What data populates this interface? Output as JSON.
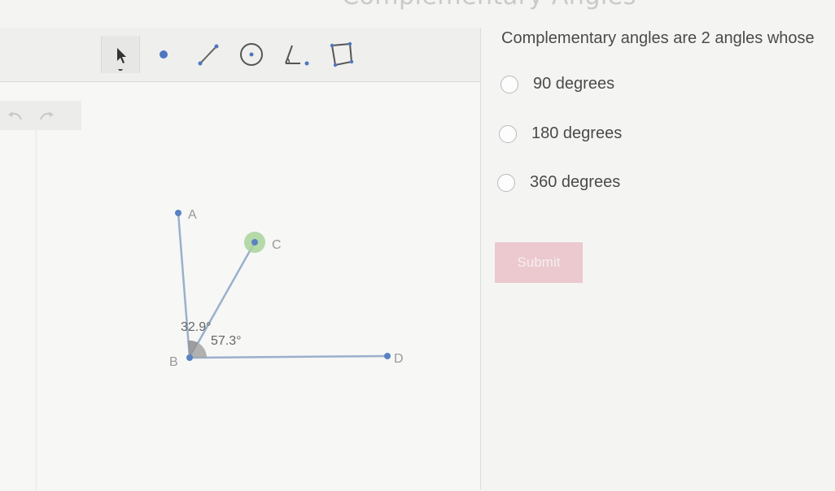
{
  "page": {
    "title": "Complementary Angles"
  },
  "toolbar": {
    "tools": [
      "arrow-select-icon",
      "point-icon",
      "segment-icon",
      "circle-icon",
      "angle-icon",
      "polygon-icon"
    ]
  },
  "history": {
    "undo_icon": "undo-icon",
    "redo_icon": "redo-icon"
  },
  "figure": {
    "points": {
      "A": "A",
      "B": "B",
      "C": "C",
      "D": "D"
    },
    "angles": {
      "ABC": "32.9°",
      "CBD": "57.3°"
    }
  },
  "question": {
    "prompt": "Complementary angles are 2 angles whose",
    "options": [
      "90 degrees",
      "180 degrees",
      "360 degrees"
    ],
    "submit_label": "Submit"
  },
  "colors": {
    "line": "#9ab0cc",
    "point": "#5a82c2",
    "angle_fill": "#9a9a9a",
    "selected_halo": "#a9d39a",
    "submit_bg": "#ebc9cf"
  }
}
